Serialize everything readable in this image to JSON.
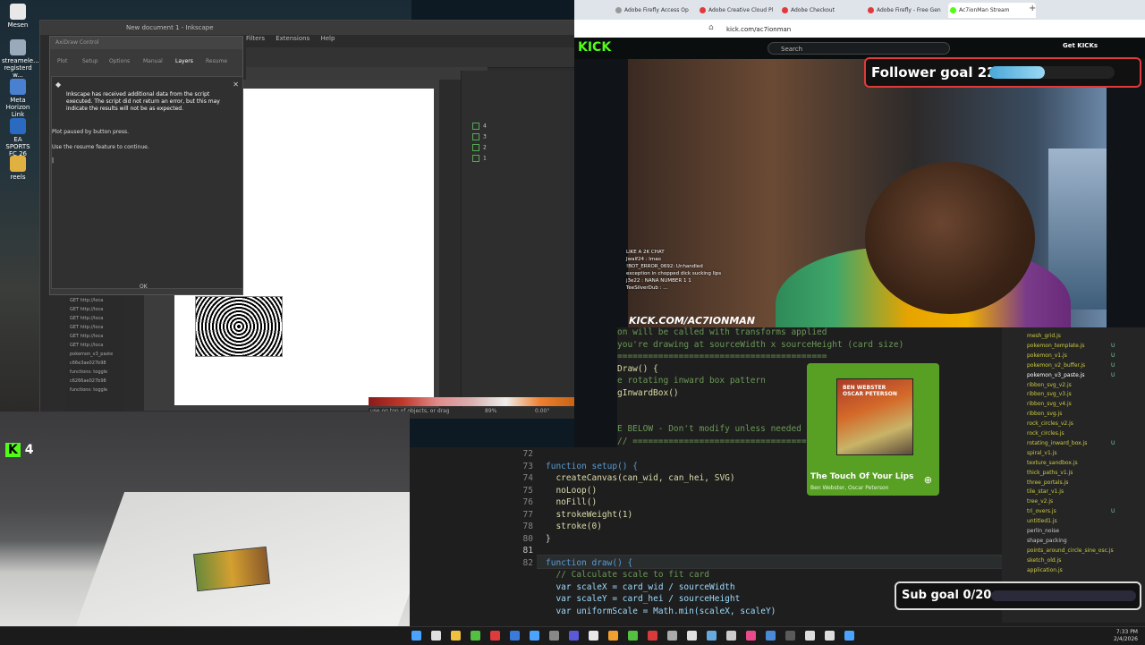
{
  "desktop": {
    "icons": [
      {
        "label": "Mesen",
        "color": "#e8e8e8"
      },
      {
        "label": "streamele... registerd w...",
        "color": "#9ab"
      },
      {
        "label": "Meta Horizon Link",
        "color": "#4a80d0"
      },
      {
        "label": "EA SPORTS FC 26",
        "color": "#2a6ac0"
      },
      {
        "label": "reels",
        "color": "#e0b040"
      }
    ]
  },
  "inkscape": {
    "title": "New document 1 - Inkscape",
    "menu": [
      "Filters",
      "Extensions",
      "Help"
    ],
    "layers": [
      {
        "name": "4",
        "color": "#5aa"
      },
      {
        "name": "3",
        "color": "#d33"
      },
      {
        "name": "2",
        "color": "#cc3"
      },
      {
        "name": "1",
        "color": "#5a5"
      }
    ],
    "status_hint": "use on top of objects, or drag",
    "zoom": "89%",
    "rotation": "0.00°"
  },
  "axidraw": {
    "title": "AxiDraw Control",
    "tabs": [
      "Plot",
      "Setup",
      "Options",
      "Manual",
      "Layers",
      "Resume"
    ],
    "message_head": "Inkscape has received additional data from the script executed. The script did not return an error, but this may indicate the results will not be as expected.",
    "lines": [
      "Plot paused by button press.",
      "Use the resume feature to continue."
    ],
    "ok_label": "OK",
    "url_list": [
      "GET http://loca",
      "GET http://loca",
      "GET http://loca",
      "GET http://loca",
      "GET http://loca",
      "GET http://loca",
      "pokemon_v3_paste",
      "c66e3ae027b98",
      "functions: toggle",
      "c6266ae027b98",
      "functions: toggle"
    ]
  },
  "browser": {
    "tabs": [
      {
        "label": "Adobe Firefly Access Op",
        "color": "#999"
      },
      {
        "label": "Adobe Creative Cloud Pl",
        "color": "#e03a3a"
      },
      {
        "label": "Adobe Checkout",
        "color": "#e03a3a"
      },
      {
        "label": "Adobe Firefly - Free Gen",
        "color": "#e03a3a"
      },
      {
        "label": "Ac7ionMan Stream",
        "color": "#53fc18"
      }
    ],
    "url": "kick.com/ac7ionman",
    "search_placeholder": "Search",
    "get_kicks": "Get KICKs",
    "logo": "KICK"
  },
  "stream": {
    "follower_goal": {
      "label": "Follower goal 22/50",
      "current": 22,
      "target": 50
    },
    "sub_goal": {
      "label": "Sub goal 0/20",
      "current": 0,
      "target": 20
    },
    "chat": [
      "LIKE A 2K CHAT",
      "Jwalf24 : lmao",
      "!BOT_ERROR_0692: Unhandled",
      "exception in chopped dick sucking lips",
      "j3e22 : NANA NUMBER 1 1",
      "TeeSilverDub : ..."
    ],
    "channel": "KICK.COM/AC7IONMAN",
    "k_badge": "K",
    "k_count": "4"
  },
  "music": {
    "title": "The Touch Of Your Lips",
    "artist": "Ben Webster, Oscar Peterson",
    "album_text": "BEN WEBSTER OSCAR PETERSON"
  },
  "code": {
    "top_lines": [
      {
        "text": "on will be called with transforms applied",
        "color": "#6a9955"
      },
      {
        "text": "you're drawing at sourceWidth x sourceHeight (card size)",
        "color": "#6a9955"
      },
      {
        "text": "=========================================",
        "color": "#6a9955"
      },
      {
        "text": "Draw() {",
        "color": "#dcdcaa"
      },
      {
        "text": "e rotating inward box pattern",
        "color": "#6a9955"
      },
      {
        "text": "gInwardBox()",
        "color": "#dcdcaa"
      },
      {
        "text": "",
        "color": "#d4d4d4"
      },
      {
        "text": "",
        "color": "#d4d4d4"
      },
      {
        "text": "E BELOW - Don't modify unless needed",
        "color": "#6a9955"
      },
      {
        "text": "// ===================================",
        "color": "#6a9955"
      }
    ],
    "lines": [
      {
        "n": "72",
        "text": "",
        "color": "#d4d4d4"
      },
      {
        "n": "73",
        "text": "function setup() {",
        "color": "#569cd6"
      },
      {
        "n": "74",
        "text": "  createCanvas(can_wid, can_hei, SVG)",
        "color": "#dcdcaa"
      },
      {
        "n": "75",
        "text": "  noLoop()",
        "color": "#dcdcaa"
      },
      {
        "n": "76",
        "text": "  noFill()",
        "color": "#dcdcaa"
      },
      {
        "n": "77",
        "text": "  strokeWeight(1)",
        "color": "#dcdcaa"
      },
      {
        "n": "78",
        "text": "  stroke(0)",
        "color": "#dcdcaa"
      },
      {
        "n": "80",
        "text": "}",
        "color": "#d4d4d4"
      },
      {
        "n": "81",
        "text": "",
        "color": "#d4d4d4"
      },
      {
        "n": "82",
        "text": "function draw() {",
        "color": "#569cd6"
      },
      {
        "n": "",
        "text": "  // Calculate scale to fit card",
        "color": "#6a9955"
      },
      {
        "n": "",
        "text": "  var scaleX = card_wid / sourceWidth",
        "color": "#9cdcfe"
      },
      {
        "n": "",
        "text": "  var scaleY = card_hei / sourceHeight",
        "color": "#9cdcfe"
      },
      {
        "n": "",
        "text": "  var uniformScale = Math.min(scaleX, scaleY)",
        "color": "#9cdcfe"
      }
    ]
  },
  "file_tree": [
    {
      "name": "mesh_grid.js",
      "mark": ""
    },
    {
      "name": "pokemon_template.js",
      "mark": "U"
    },
    {
      "name": "pokemon_v1.js",
      "mark": "U"
    },
    {
      "name": "pokemon_v2_buffer.js",
      "mark": "U"
    },
    {
      "name": "pokemon_v3_paste.js",
      "mark": "U"
    },
    {
      "name": "ribbon_svg_v2.js",
      "mark": ""
    },
    {
      "name": "ribbon_svg_v3.js",
      "mark": ""
    },
    {
      "name": "ribbon_svg_v4.js",
      "mark": ""
    },
    {
      "name": "ribbon_svg.js",
      "mark": ""
    },
    {
      "name": "rock_circles_v2.js",
      "mark": ""
    },
    {
      "name": "rock_circles.js",
      "mark": ""
    },
    {
      "name": "rotating_inward_box.js",
      "mark": "U"
    },
    {
      "name": "spiral_v1.js",
      "mark": ""
    },
    {
      "name": "texture_sandbox.js",
      "mark": ""
    },
    {
      "name": "thick_paths_v1.js",
      "mark": ""
    },
    {
      "name": "three_portals.js",
      "mark": ""
    },
    {
      "name": "tile_star_v1.js",
      "mark": ""
    },
    {
      "name": "tree_v2.js",
      "mark": ""
    },
    {
      "name": "tri_overs.js",
      "mark": "U"
    },
    {
      "name": "untitled1.js",
      "mark": ""
    },
    {
      "name": "perlin_noise",
      "mark": ""
    },
    {
      "name": "shape_packing",
      "mark": ""
    },
    {
      "name": "points_around_circle_sine_osc.js",
      "mark": ""
    },
    {
      "name": "sketch_old.js",
      "mark": ""
    },
    {
      "name": "application.js",
      "mark": ""
    }
  ],
  "taskbar": {
    "icons": [
      "#4aa3ff",
      "#e0e0e0",
      "#f0c040",
      "#53c040",
      "#e03a3a",
      "#3a7ad8",
      "#4aa3ff",
      "#888",
      "#5a5ad8",
      "#e8e8e8",
      "#f0a030",
      "#53c040",
      "#d83a3a",
      "#aaa",
      "#e0e0e0",
      "#6ad",
      "#ccc",
      "#e84a8a",
      "#4a8ad8",
      "#5a5a5a",
      "#ddd",
      "#ddd",
      "#4aa3ff"
    ],
    "time": "7:33 PM",
    "date": "2/4/2026"
  },
  "colors": {
    "kick_green": "#53fc18",
    "goal_border": "#e03a3a",
    "spotify_green": "#58a023"
  }
}
